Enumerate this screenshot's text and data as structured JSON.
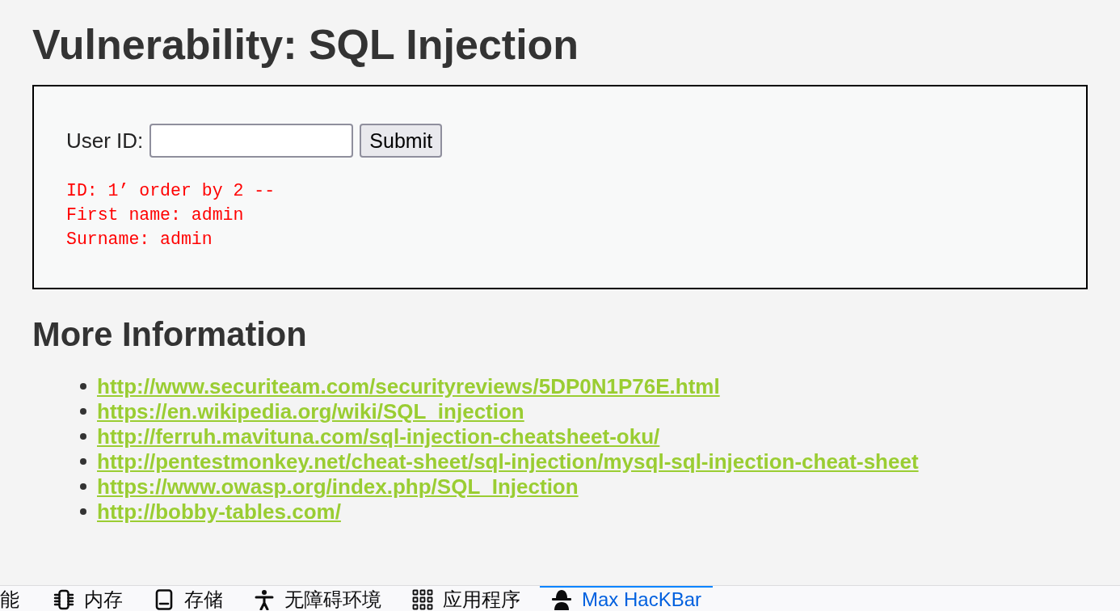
{
  "page": {
    "title": "Vulnerability: SQL Injection"
  },
  "form": {
    "label": "User ID:",
    "submit_button": "Submit"
  },
  "result_lines": [
    "ID: 1’ order by 2 --",
    "First name: admin",
    "Surname: admin"
  ],
  "more_information": {
    "heading": "More Information",
    "links": [
      "http://www.securiteam.com/securityreviews/5DP0N1P76E.html",
      "https://en.wikipedia.org/wiki/SQL_injection",
      "http://ferruh.mavituna.com/sql-injection-cheatsheet-oku/",
      "http://pentestmonkey.net/cheat-sheet/sql-injection/mysql-sql-injection-cheat-sheet",
      "https://www.owasp.org/index.php/SQL_Injection",
      "http://bobby-tables.com/"
    ]
  },
  "devtools_tabs": [
    {
      "label": "能",
      "selected": false
    },
    {
      "label": "内存",
      "selected": false
    },
    {
      "label": "存储",
      "selected": false
    },
    {
      "label": "无障碍环境",
      "selected": false
    },
    {
      "label": "应用程序",
      "selected": false
    },
    {
      "label": "Max HacKBar",
      "selected": true
    }
  ]
}
